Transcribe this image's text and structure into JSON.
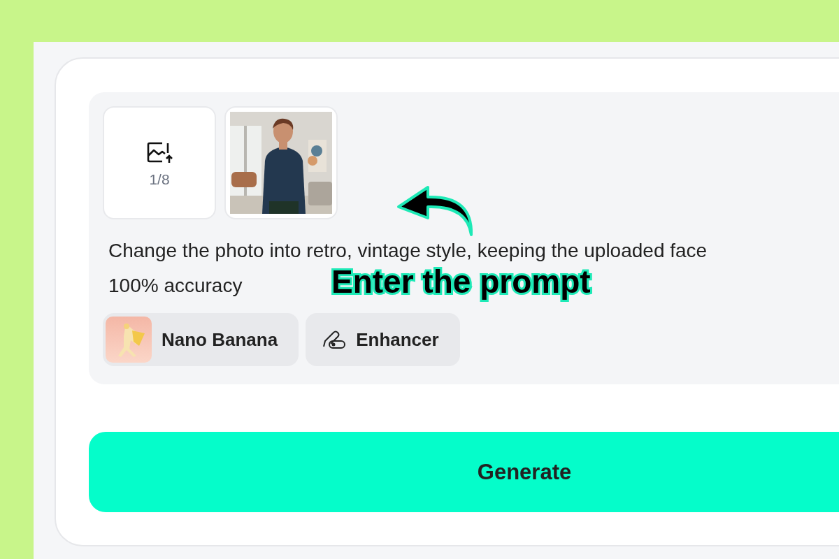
{
  "upload": {
    "count": "1/8"
  },
  "prompt": {
    "lines": [
      "Change the photo into retro, vintage style, keeping the uploaded face",
      "100% accuracy"
    ]
  },
  "chips": [
    {
      "kind": "model",
      "label": "Nano Banana"
    },
    {
      "kind": "tool",
      "label": "Enhancer"
    }
  ],
  "generate_button": {
    "label": "Generate"
  },
  "annotation": {
    "label": "Enter the prompt"
  }
}
